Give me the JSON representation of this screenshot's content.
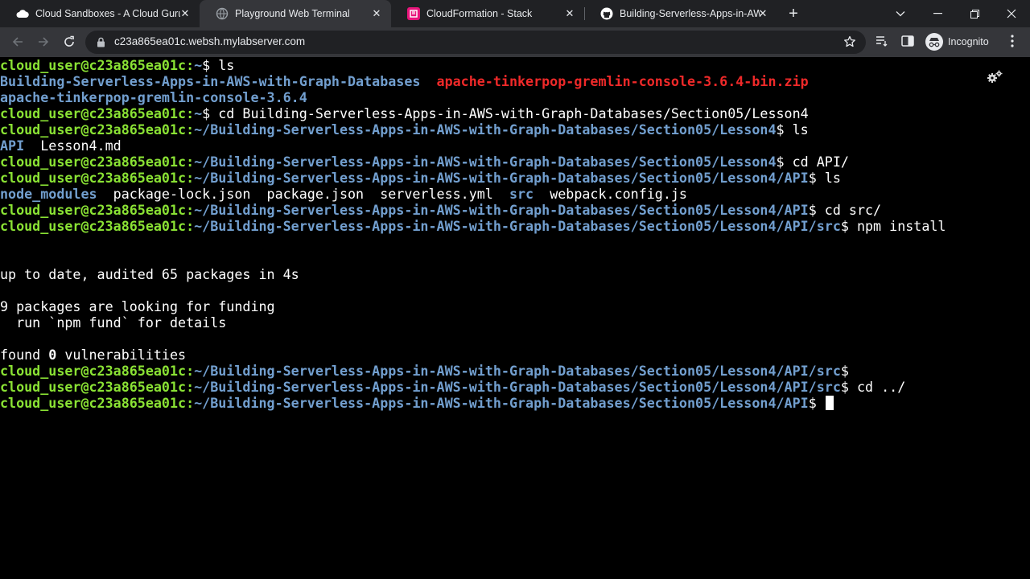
{
  "browser": {
    "tabs": [
      {
        "title": "Cloud Sandboxes - A Cloud Guru",
        "favicon": "acg-cloud-icon"
      },
      {
        "title": "Playground Web Terminal",
        "favicon": "terminal-globe-icon",
        "active": true
      },
      {
        "title": "CloudFormation - Stack",
        "favicon": "cloudformation-icon"
      },
      {
        "title": "Building-Serverless-Apps-in-AWS",
        "favicon": "github-icon"
      }
    ],
    "url": "c23a865ea01c.websh.mylabserver.com",
    "profile_label": "Incognito"
  },
  "terminal": {
    "prompt": "cloud_user@c23a865ea01c:",
    "path_home": "~",
    "path_lesson": "~/Building-Serverless-Apps-in-AWS-with-Graph-Databases/Section05/Lesson4",
    "path_api": "~/Building-Serverless-Apps-in-AWS-with-Graph-Databases/Section05/Lesson4/API",
    "path_src": "~/Building-Serverless-Apps-in-AWS-with-Graph-Databases/Section05/Lesson4/API/src",
    "suffix": "$ ",
    "suffix_bare": "$",
    "cmd_ls": "ls",
    "out1_dir": "Building-Serverless-Apps-in-AWS-with-Graph-Databases",
    "out1_zip": "apache-tinkerpop-gremlin-console-3.6.4-bin.zip",
    "out2_dir": "apache-tinkerpop-gremlin-console-3.6.4",
    "cmd_cd_lesson": "cd Building-Serverless-Apps-in-AWS-with-Graph-Databases/Section05/Lesson4",
    "out_lesson_dir": "API",
    "out_lesson_file": "Lesson4.md",
    "cmd_cd_api": "cd API/",
    "out_api_dir1": "node_modules",
    "out_api_file1": "package-lock.json",
    "out_api_file2": "package.json",
    "out_api_file3": "serverless.yml",
    "out_api_dir2": "src",
    "out_api_file4": "webpack.config.js",
    "cmd_cd_src": "cd src/",
    "cmd_npm": "npm install",
    "npm_uptodate": "up to date, audited 65 packages in 4s",
    "npm_funding": "9 packages are looking for funding",
    "npm_fund_hint": "  run `npm fund` for details",
    "npm_found": "found ",
    "npm_zero": "0",
    "npm_vuln": " vulnerabilities",
    "cmd_cd_up": "cd ../"
  },
  "colors": {
    "prompt": "#8ae234",
    "path": "#729fcf",
    "archive": "#ef2929",
    "background": "#000000"
  }
}
